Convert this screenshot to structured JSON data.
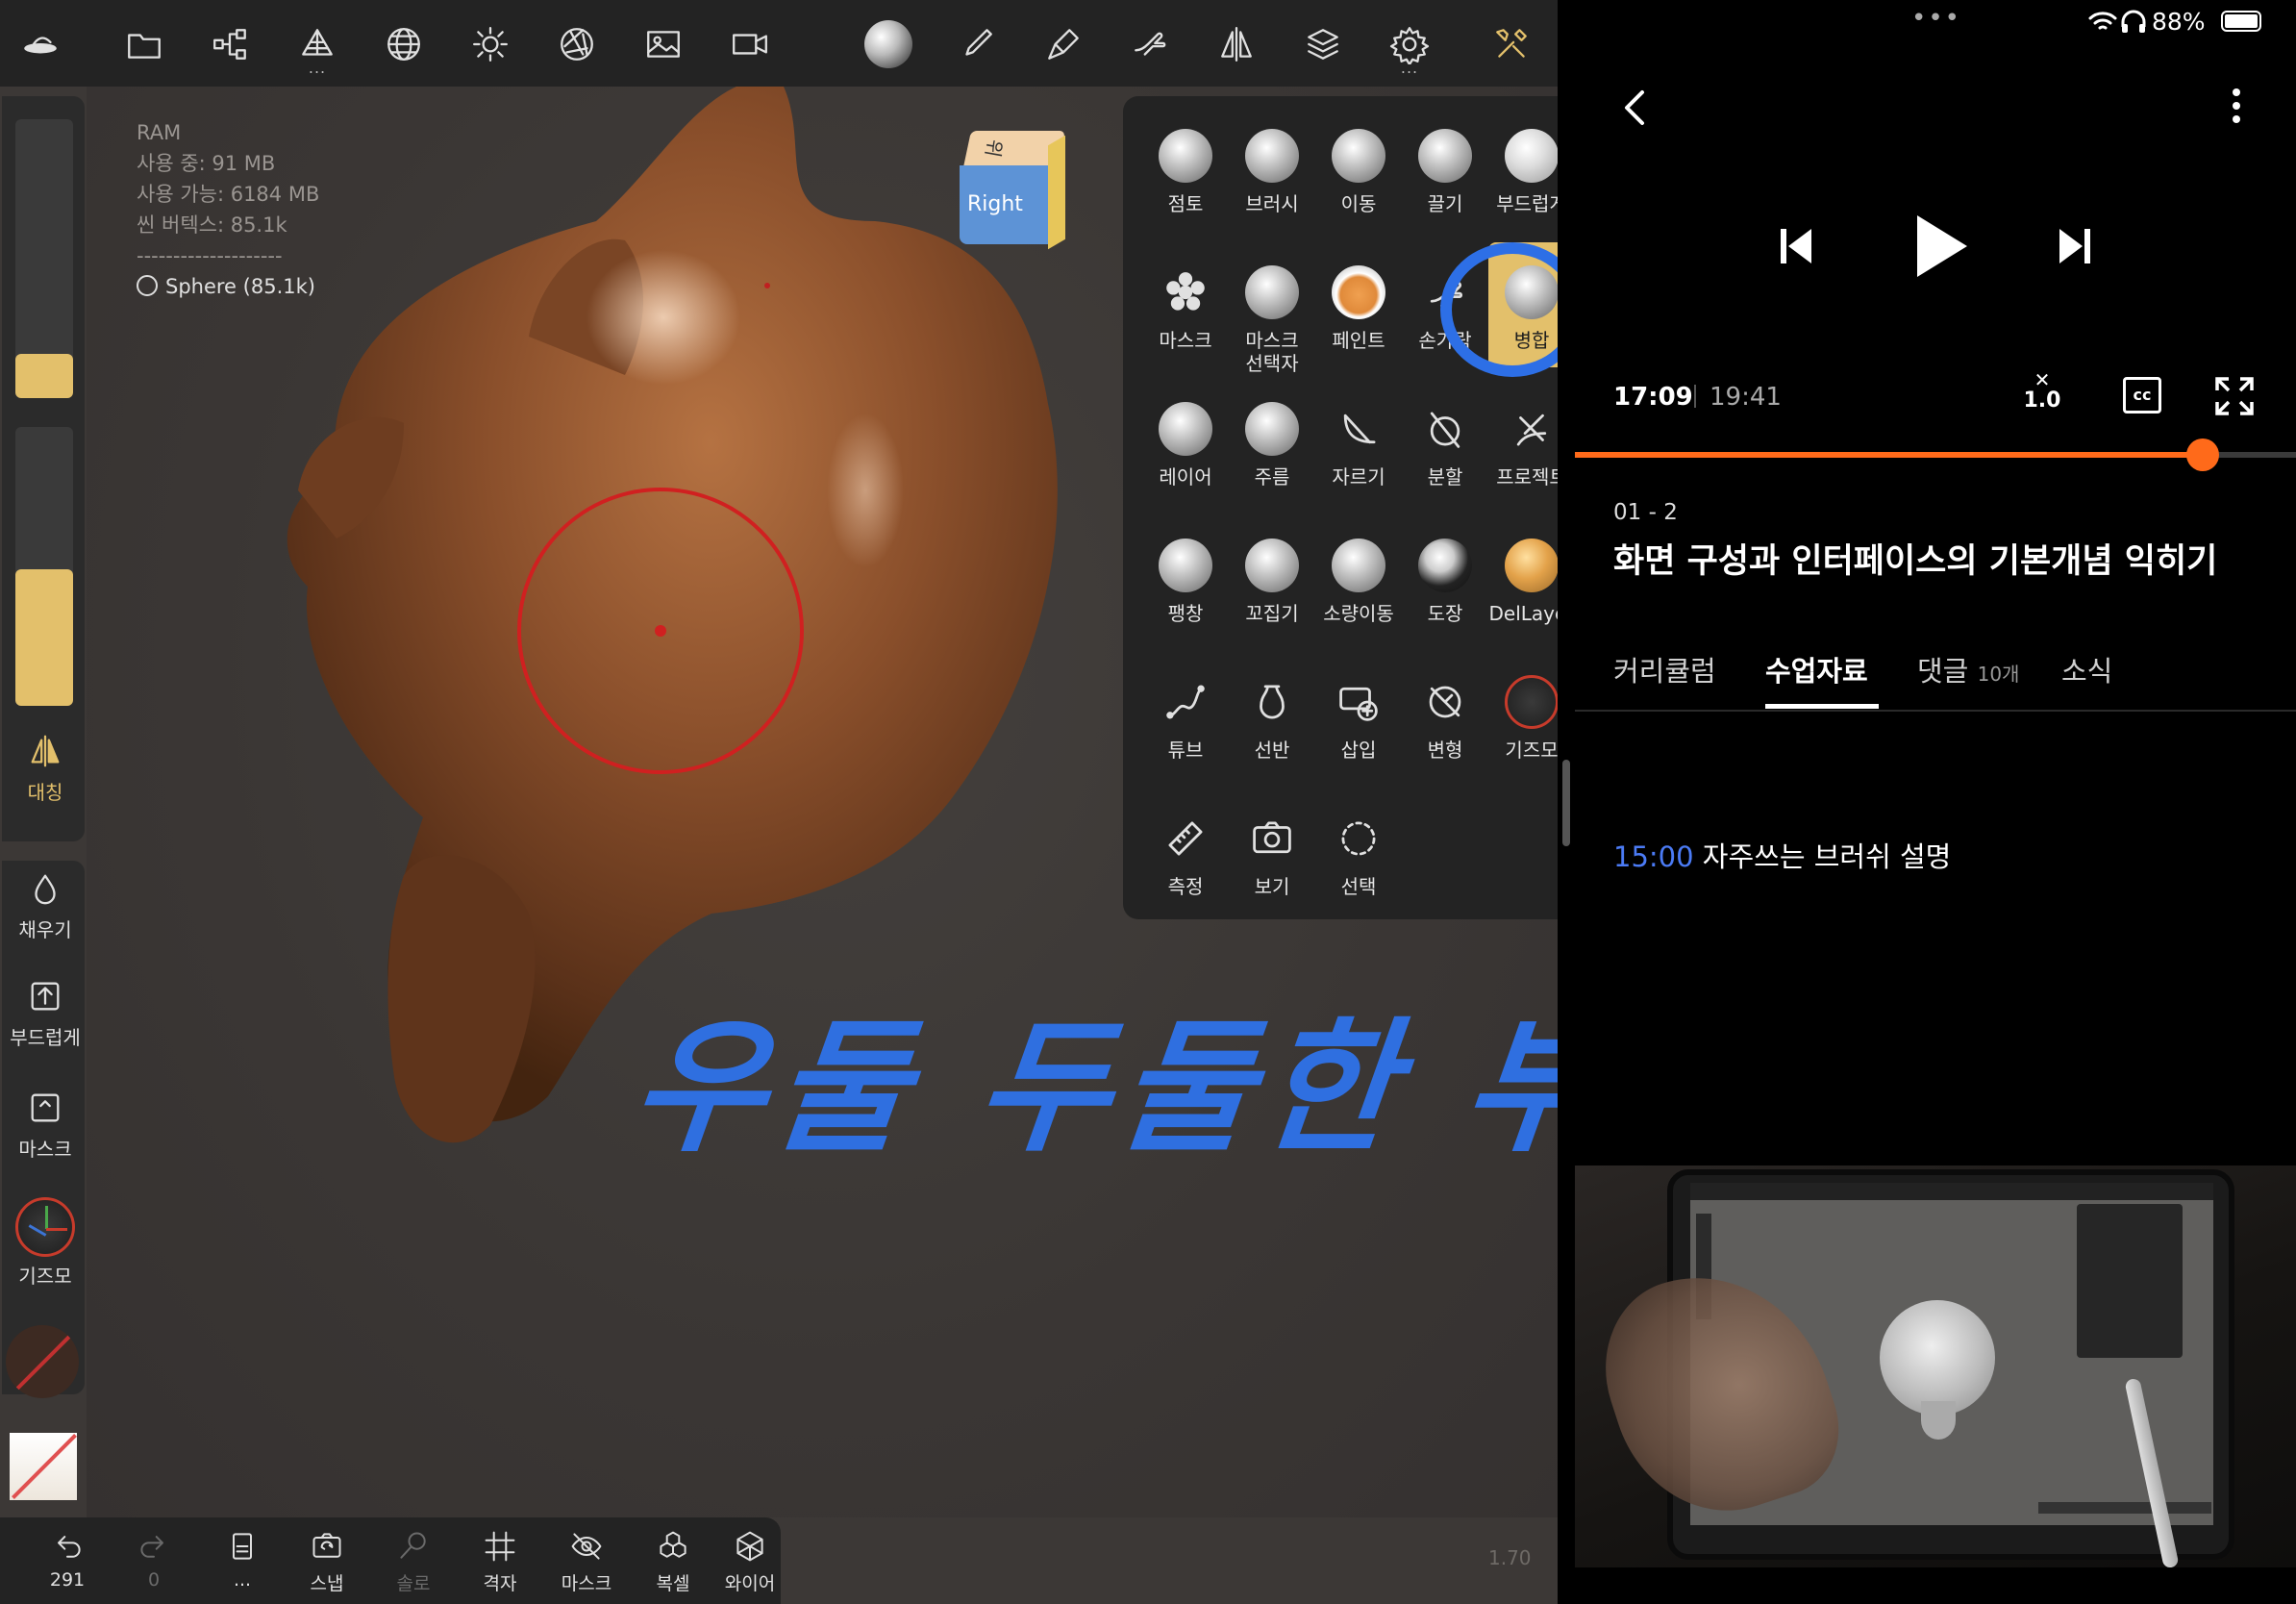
{
  "stats": {
    "ram_label": "RAM",
    "used": "사용 중: 91 MB",
    "available": "사용 가능: 6184 MB",
    "vertices": "씬 버텍스: 85.1k",
    "divider": "--------------------",
    "mesh": "Sphere (85.1k)"
  },
  "topbar": {
    "icons": [
      "nomad-logo-icon",
      "folder-icon",
      "scene-graph-icon",
      "topology-icon",
      "wireframe-sphere-icon",
      "light-icon",
      "camera-aperture-icon",
      "image-icon",
      "video-icon",
      "material-sphere-icon",
      "paint-brush-icon",
      "stroke-icon",
      "hand-icon",
      "symmetry-icon",
      "layers-icon",
      "settings-icon",
      "tools-icon"
    ]
  },
  "view_cube": {
    "top": "위",
    "front": "Right"
  },
  "sidebar": {
    "symmetry_label": "대칭",
    "fill_label": "채우기",
    "smooth_label": "부드럽게",
    "mask_label": "마스크",
    "gizmo_label": "기즈모"
  },
  "tools": [
    {
      "label": "점토",
      "icon": "clay-icon"
    },
    {
      "label": "브러시",
      "icon": "brush-icon"
    },
    {
      "label": "이동",
      "icon": "move-icon"
    },
    {
      "label": "끌기",
      "icon": "drag-icon"
    },
    {
      "label": "부드럽게",
      "icon": "smooth-icon"
    },
    {
      "label": "마스크",
      "icon": "mask-icon"
    },
    {
      "label": "마스크\n선택자",
      "icon": "mask-selector-icon"
    },
    {
      "label": "페인트",
      "icon": "paint-icon"
    },
    {
      "label": "손가락",
      "icon": "smudge-icon"
    },
    {
      "label": "병합",
      "icon": "flatten-icon"
    },
    {
      "label": "레이어",
      "icon": "layer-icon"
    },
    {
      "label": "주름",
      "icon": "crease-icon"
    },
    {
      "label": "자르기",
      "icon": "trim-icon"
    },
    {
      "label": "분할",
      "icon": "split-icon"
    },
    {
      "label": "프로젝트",
      "icon": "project-icon"
    },
    {
      "label": "팽창",
      "icon": "inflate-icon"
    },
    {
      "label": "꼬집기",
      "icon": "pinch-icon"
    },
    {
      "label": "소량이동",
      "icon": "nudge-icon"
    },
    {
      "label": "도장",
      "icon": "stamp-icon"
    },
    {
      "label": "DelLayer",
      "icon": "del-layer-icon"
    },
    {
      "label": "튜브",
      "icon": "tube-icon"
    },
    {
      "label": "선반",
      "icon": "lathe-icon"
    },
    {
      "label": "삽입",
      "icon": "insert-icon"
    },
    {
      "label": "변형",
      "icon": "transform-icon"
    },
    {
      "label": "기즈모",
      "icon": "gizmo-icon"
    },
    {
      "label": "측정",
      "icon": "measure-icon"
    },
    {
      "label": "보기",
      "icon": "view-icon"
    },
    {
      "label": "선택",
      "icon": "select-icon"
    }
  ],
  "bottombar": {
    "undo_count": "291",
    "redo_count": "0",
    "history_dots": "...",
    "snap": "스냅",
    "solo": "솔로",
    "grid": "격자",
    "mask": "마스크",
    "instance": "복셀",
    "wireframe": "와이어"
  },
  "version": "1.70",
  "annotation_text": "우둘 두둘한 부분 누름",
  "video": {
    "status": {
      "dots": "•••",
      "battery": "88%"
    },
    "current_time": "17:09",
    "duration": "19:41",
    "speed": "1.0",
    "progress": 0.871,
    "episode": "01 - 2",
    "title": "화면 구성과 인터페이스의 기본개념 익히기",
    "tabs": [
      "커리큘럼",
      "수업자료",
      "댓글",
      "소식"
    ],
    "comment_count": "10개",
    "active_tab": "수업자료",
    "chapter_time": "15:00",
    "chapter_text": "자주쓰는 브러쉬 설명",
    "colors": {
      "accent": "#ff6a1a",
      "link": "#4b7bf5",
      "annotation": "#2f6fe0",
      "tool_active": "#e3c06b"
    }
  }
}
